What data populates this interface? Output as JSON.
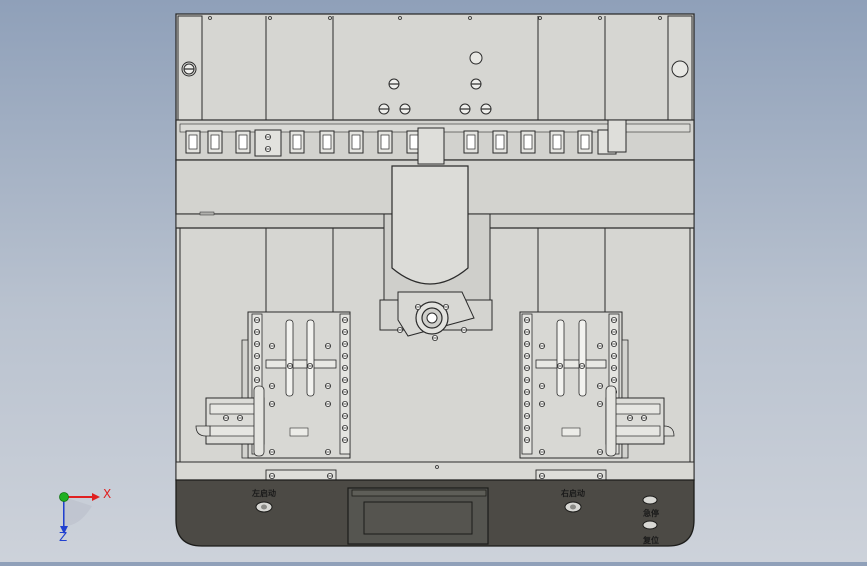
{
  "panel": {
    "left_start_label": "左启动",
    "right_start_label": "右启动",
    "stop_label": "急停",
    "reset_label": "复位"
  },
  "axes": {
    "x_label": "X",
    "z_label": "Z"
  },
  "colors": {
    "body": "#d6d6d2",
    "line": "#2b2b2b",
    "panel": "#4c4a45",
    "axis_x": "#e02020",
    "axis_y": "#20b020",
    "axis_z": "#2040d0"
  }
}
